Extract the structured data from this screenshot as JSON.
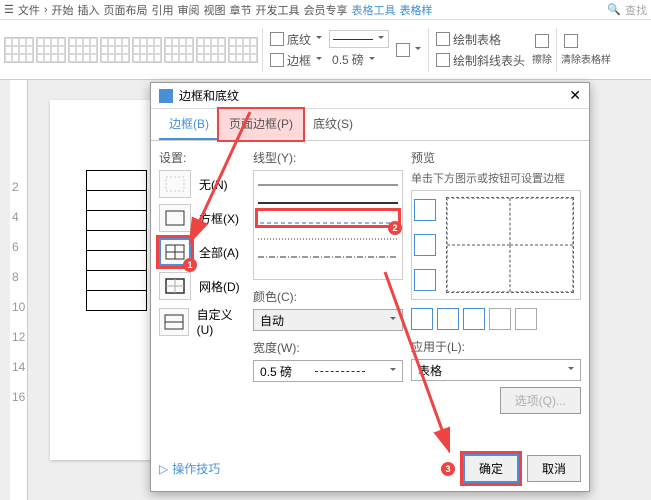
{
  "topbar": {
    "file": "文件",
    "tabs": [
      "开始",
      "插入",
      "页面布局",
      "引用",
      "审阅",
      "视图",
      "章节",
      "开发工具",
      "会员专享"
    ],
    "tool1": "表格工具",
    "tool2": "表格样",
    "search": "查找"
  },
  "ribbon": {
    "shading": "底纹",
    "border": "边框",
    "width": "0.5",
    "unit": "磅",
    "draw": "绘制表格",
    "diag": "绘制斜线表头",
    "erase": "擦除",
    "clear": "清除表格样"
  },
  "dialog": {
    "title": "边框和底纹",
    "tabs": {
      "border": "边框(B)",
      "page": "页面边框(P)",
      "shading": "底纹(S)"
    },
    "setting": "设置:",
    "opts": {
      "none": "无(N)",
      "box": "方框(X)",
      "all": "全部(A)",
      "grid": "网格(D)",
      "custom": "自定义(U)"
    },
    "linetype": "线型(Y):",
    "color": "颜色(C):",
    "color_auto": "自动",
    "width": "宽度(W):",
    "width_val": "0.5 磅",
    "preview": "预览",
    "preview_hint": "单击下方图示或按钮可设置边框",
    "apply": "应用于(L):",
    "apply_val": "表格",
    "options": "选项(Q)...",
    "tips": "操作技巧",
    "ok": "确定",
    "cancel": "取消"
  },
  "badges": {
    "b1": "1",
    "b2": "2",
    "b3": "3"
  }
}
